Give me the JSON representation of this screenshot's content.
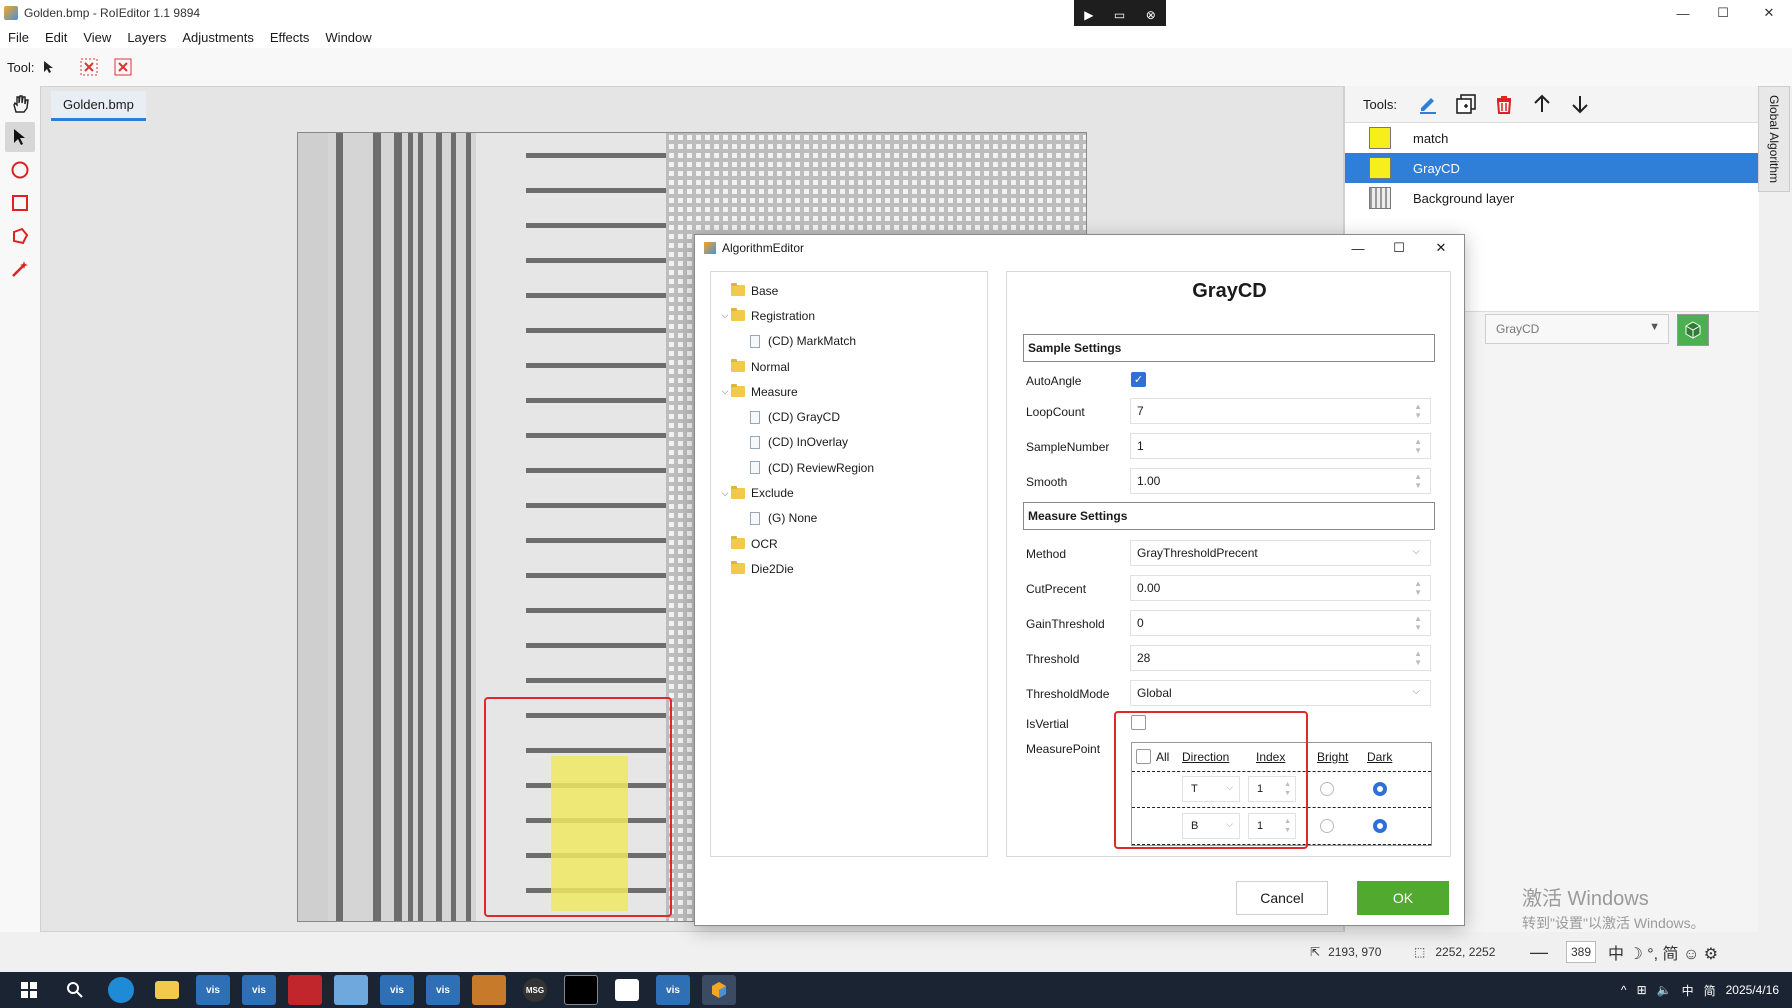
{
  "window": {
    "title": "Golden.bmp - RoIEditor 1.1 9894",
    "minimize": "—",
    "maximize": "☐",
    "close": "✕"
  },
  "remote_bar": {
    "icons": [
      "▶",
      "▭",
      "⊗"
    ]
  },
  "menu": [
    "File",
    "Edit",
    "View",
    "Layers",
    "Adjustments",
    "Effects",
    "Window"
  ],
  "toolbar": {
    "label": "Tool:",
    "icons": [
      "pointer-icon",
      "delete-x-icon",
      "delete-x-alt-icon"
    ]
  },
  "left_tools": [
    "hand-icon",
    "pointer-icon",
    "circle-icon",
    "rectangle-icon",
    "polygon-icon",
    "magic-wand-icon"
  ],
  "document": {
    "tab": "Golden.bmp"
  },
  "right_panel": {
    "tools_label": "Tools:",
    "tool_icons": [
      "edit-pencil-icon",
      "add-layer-icon",
      "trash-icon",
      "arrow-up-icon",
      "arrow-down-icon"
    ],
    "layers": [
      {
        "name": "match",
        "color": "#f7ef1b",
        "selected": false
      },
      {
        "name": "GrayCD",
        "color": "#f7ef1b",
        "selected": true
      },
      {
        "name": "Background layer",
        "color": "#cccccc",
        "selected": false
      }
    ],
    "combo_value": "GrayCD",
    "side_tab": "Global Algorithm"
  },
  "watermark": {
    "line1": "激活 Windows",
    "line2": "转到\"设置\"以激活 Windows。"
  },
  "status": {
    "cursor": "2193, 970",
    "size": "2252, 2252",
    "zoom": "389"
  },
  "taskbar": {
    "apps": [
      "vis",
      "vis",
      "vis",
      "vis",
      "vis",
      "MSG"
    ],
    "tray": [
      "中",
      "简",
      "2025/4/16"
    ]
  },
  "dialog": {
    "title": "AlgorithmEditor",
    "tree": [
      {
        "label": "Base",
        "type": "folder",
        "level": 0,
        "expanded": null
      },
      {
        "label": "Registration",
        "type": "folder",
        "level": 0,
        "expanded": true
      },
      {
        "label": "(CD) MarkMatch",
        "type": "file",
        "level": 1
      },
      {
        "label": "Normal",
        "type": "folder",
        "level": 0,
        "expanded": null
      },
      {
        "label": "Measure",
        "type": "folder",
        "level": 0,
        "expanded": true
      },
      {
        "label": "(CD) GrayCD",
        "type": "file",
        "level": 1
      },
      {
        "label": "(CD) InOverlay",
        "type": "file",
        "level": 1
      },
      {
        "label": "(CD) ReviewRegion",
        "type": "file",
        "level": 1
      },
      {
        "label": "Exclude",
        "type": "folder",
        "level": 0,
        "expanded": true
      },
      {
        "label": "(G) None",
        "type": "file",
        "level": 1
      },
      {
        "label": "OCR",
        "type": "folder",
        "level": 0,
        "expanded": null
      },
      {
        "label": "Die2Die",
        "type": "folder",
        "level": 0,
        "expanded": null
      }
    ],
    "heading": "GrayCD",
    "sample_settings": {
      "title": "Sample Settings",
      "auto_angle_label": "AutoAngle",
      "auto_angle": true,
      "loop_count_label": "LoopCount",
      "loop_count": "7",
      "sample_number_label": "SampleNumber",
      "sample_number": "1",
      "smooth_label": "Smooth",
      "smooth": "1.00"
    },
    "measure_settings": {
      "title": "Measure Settings",
      "method_label": "Method",
      "method": "GrayThresholdPrecent",
      "cut_precent_label": "CutPrecent",
      "cut_precent": "0.00",
      "gain_threshold_label": "GainThreshold",
      "gain_threshold": "0",
      "threshold_label": "Threshold",
      "threshold": "28",
      "threshold_mode_label": "ThresholdMode",
      "threshold_mode": "Global",
      "is_vertial_label": "IsVertial",
      "is_vertial": false,
      "measure_point_label": "MeasurePoint"
    },
    "measure_point": {
      "headers": {
        "all": "All",
        "direction": "Direction",
        "index": "Index",
        "bright": "Bright",
        "dark": "Dark"
      },
      "rows": [
        {
          "direction": "T",
          "index": "1",
          "selected": "Dark"
        },
        {
          "direction": "B",
          "index": "1",
          "selected": "Dark"
        }
      ]
    },
    "cancel": "Cancel",
    "ok": "OK"
  }
}
